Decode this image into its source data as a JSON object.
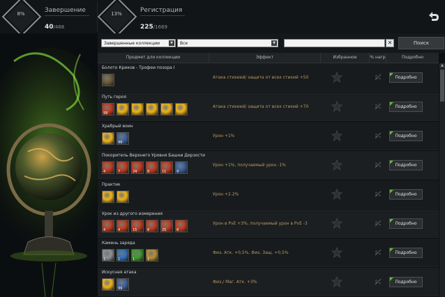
{
  "stats": {
    "completion": {
      "label": "Завершение",
      "percent": "8%",
      "value": "40",
      "total": "/468"
    },
    "registration": {
      "label": "Регистрация",
      "percent": "13%",
      "value": "225",
      "total": "/1669"
    }
  },
  "filters": {
    "collection_select": "Завершенные коллекции",
    "type_select": "Все",
    "search_value": "",
    "clear_label": "✕",
    "search_button": "Поиск"
  },
  "table": {
    "headers": {
      "item": "Предмет для коллекции",
      "effect": "Эффект",
      "favorite": "Избранное",
      "percent": "% нагр",
      "details": "Подробно"
    },
    "rows": [
      {
        "name": "Болото Криков - Трофеи позора I",
        "effect": "Атака стихией/ защита от всех стихий +50",
        "details": "Подробно",
        "items": [
          {
            "kind": "scroll",
            "level": ""
          }
        ]
      },
      {
        "name": "Путь героя",
        "effect": "Атака стихией/ защита от всех стихий +70",
        "details": "Подробно",
        "items": [
          {
            "kind": "red",
            "level": "99"
          },
          {
            "kind": "gold",
            "level": ""
          },
          {
            "kind": "gold",
            "level": ""
          },
          {
            "kind": "gold",
            "level": ""
          },
          {
            "kind": "gold",
            "level": ""
          },
          {
            "kind": "gold",
            "level": ""
          }
        ]
      },
      {
        "name": "Храбрый воин",
        "effect": "Урон +1%",
        "details": "Подробно",
        "items": [
          {
            "kind": "gold",
            "level": ""
          },
          {
            "kind": "flask",
            "level": "99"
          }
        ]
      },
      {
        "name": "Покоритель Верхнего Уровня Башни Дерзости",
        "effect": "Урон +1%, получаемый урон -1%",
        "details": "Подробно",
        "items": [
          {
            "kind": "red",
            "level": "4"
          },
          {
            "kind": "red",
            "level": "7"
          },
          {
            "kind": "red",
            "level": "24"
          },
          {
            "kind": "red",
            "level": "8"
          },
          {
            "kind": "red",
            "level": "11"
          },
          {
            "kind": "flask",
            "level": "9"
          }
        ]
      },
      {
        "name": "Практик",
        "effect": "Урон +2.2%",
        "details": "Подробно",
        "items": [
          {
            "kind": "gold",
            "level": ""
          },
          {
            "kind": "gold",
            "level": ""
          }
        ]
      },
      {
        "name": "Урок из другого измерения",
        "effect": "Урон в PvE +3%, получаемый урон в PvE -3",
        "details": "Подробно",
        "items": [
          {
            "kind": "red",
            "level": "4"
          },
          {
            "kind": "red",
            "level": "4"
          },
          {
            "kind": "red",
            "level": "15"
          },
          {
            "kind": "red",
            "level": "8"
          },
          {
            "kind": "red",
            "level": "25"
          },
          {
            "kind": "red",
            "level": "8"
          }
        ]
      },
      {
        "name": "Камень заряда",
        "effect": "Физ. Атк. +0,5%, Физ. Защ. +0,5%",
        "details": "Подробно",
        "items": [
          {
            "kind": "silver",
            "level": "1"
          },
          {
            "kind": "blue",
            "level": "1"
          },
          {
            "kind": "green",
            "level": "1"
          },
          {
            "kind": "goldstone",
            "level": "1"
          }
        ]
      },
      {
        "name": "Искусная атака",
        "effect": "Физ./ Маг. Атк. +3%",
        "details": "Подробно",
        "items": [
          {
            "kind": "gold",
            "level": ""
          },
          {
            "kind": "flask",
            "level": "99"
          }
        ]
      }
    ]
  },
  "colors": {
    "gold": "#f0b415",
    "red": "#c23a1c",
    "blue": "#2f6fb8",
    "green": "#3f9b2c",
    "silver": "#8d9196",
    "goldstone": "#b8912f",
    "flask": "#3a5f9a",
    "scroll": "#6b5a35",
    "effect_text": "#b99a66",
    "accent_green": "#6ab63c"
  },
  "icons": {
    "back": "back-arrow-icon",
    "favorite": "star-icon",
    "percent": "percent-load-icon"
  }
}
